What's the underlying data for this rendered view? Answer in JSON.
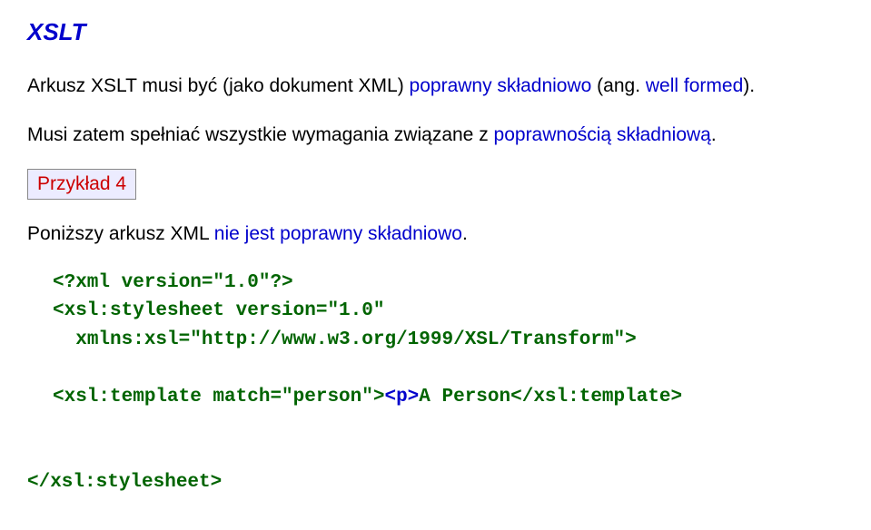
{
  "title": "XSLT",
  "para1_a": "Arkusz XSLT musi być (jako dokument XML) ",
  "para1_b": "poprawny składniowo ",
  "para1_c": "(ang. ",
  "para1_d": "well formed",
  "para1_e": ").",
  "para2_a": "Musi zatem spełniać wszystkie wymagania związane z ",
  "para2_b": "poprawnością składniową",
  "para2_c": ".",
  "example_label": "Przykład 4",
  "para3_a": "Poniższy arkusz XML ",
  "para3_b": "nie jest poprawny składniowo",
  "para3_c": ".",
  "code": {
    "l1": "<?xml version=\"1.0\"?>",
    "l2": "<xsl:stylesheet version=\"1.0\"",
    "l3": "xmlns:xsl=\"http://www.w3.org/1999/XSL/Transform\">",
    "l4a": "<xsl:template match=\"person\">",
    "l4b": "<p>",
    "l4c": "A Person",
    "l4d": "</xsl:template>",
    "l5": "</xsl:stylesheet>"
  }
}
